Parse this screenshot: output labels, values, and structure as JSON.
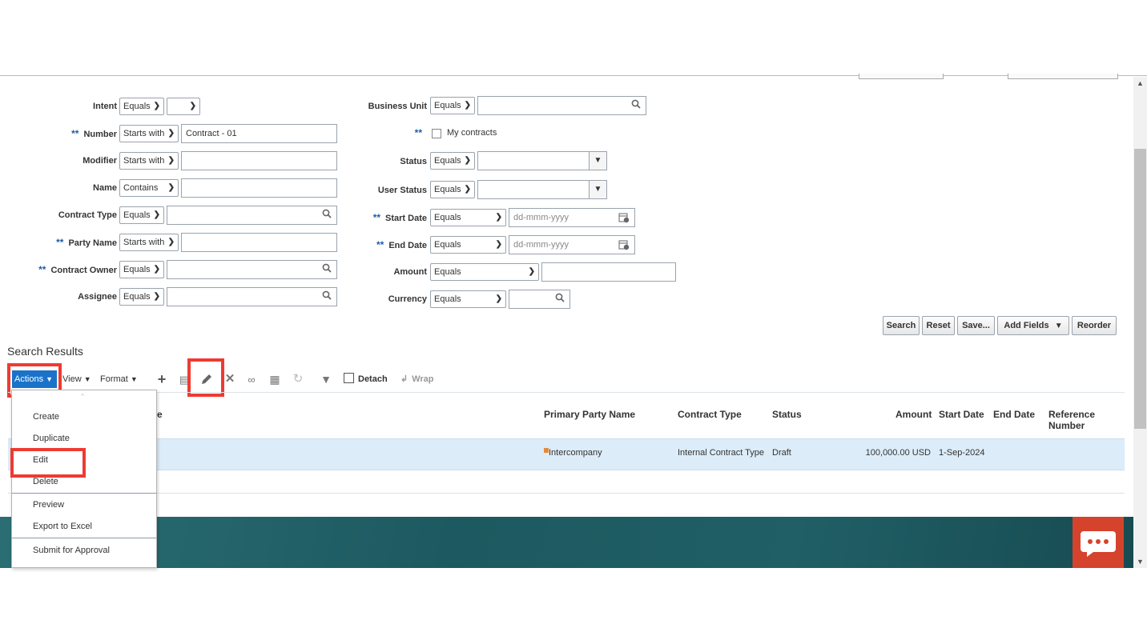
{
  "form": {
    "left": [
      {
        "label": "Intent",
        "required": false,
        "operator": "Equals",
        "value": "",
        "kind": "select-small"
      },
      {
        "label": "Number",
        "required": true,
        "operator": "Starts with",
        "value": "Contract - 01",
        "kind": "text"
      },
      {
        "label": "Modifier",
        "required": false,
        "operator": "Starts with",
        "value": "",
        "kind": "text"
      },
      {
        "label": "Name",
        "required": false,
        "operator": "Contains",
        "value": "",
        "kind": "text"
      },
      {
        "label": "Contract Type",
        "required": false,
        "operator": "Equals",
        "value": "",
        "kind": "search"
      },
      {
        "label": "Party Name",
        "required": true,
        "operator": "Starts with",
        "value": "",
        "kind": "text"
      },
      {
        "label": "Contract Owner",
        "required": true,
        "operator": "Equals",
        "value": "",
        "kind": "search"
      },
      {
        "label": "Assignee",
        "required": false,
        "operator": "Equals",
        "value": "",
        "kind": "search"
      }
    ],
    "right": {
      "business_unit": {
        "label": "Business Unit",
        "operator": "Equals",
        "value": ""
      },
      "my_contracts": {
        "label": "My contracts",
        "checked": false
      },
      "status": {
        "label": "Status",
        "operator": "Equals",
        "value": ""
      },
      "user_status": {
        "label": "User Status",
        "operator": "Equals",
        "value": ""
      },
      "start_date": {
        "label": "Start Date",
        "operator": "Equals",
        "placeholder": "dd-mmm-yyyy"
      },
      "end_date": {
        "label": "End Date",
        "operator": "Equals",
        "placeholder": "dd-mmm-yyyy"
      },
      "amount": {
        "label": "Amount",
        "operator": "Equals",
        "value": ""
      },
      "currency": {
        "label": "Currency",
        "operator": "Equals",
        "value": ""
      }
    },
    "required_marker": "**",
    "buttons": {
      "search": "Search",
      "reset": "Reset",
      "save": "Save...",
      "add_fields": "Add Fields",
      "reorder": "Reorder"
    }
  },
  "results": {
    "title": "Search Results",
    "toolbar": {
      "actions": "Actions",
      "view": "View",
      "format": "Format",
      "detach": "Detach",
      "wrap": "Wrap"
    },
    "columns": {
      "name_tail": "e",
      "primary_party": "Primary Party Name",
      "contract_type": "Contract Type",
      "status": "Status",
      "amount": "Amount",
      "start_date": "Start Date",
      "end_date": "End Date",
      "reference_line1": "Reference",
      "reference_line2": "Number"
    },
    "row": {
      "primary_party": "Intercompany",
      "contract_type": "Internal Contract Type",
      "status": "Draft",
      "amount": "100,000.00 USD",
      "start_date": "1-Sep-2024",
      "end_date": ""
    }
  },
  "actions_menu": {
    "items": [
      "Create",
      "Duplicate",
      "Edit",
      "Delete",
      "Preview",
      "Export to Excel",
      "Submit for Approval"
    ]
  },
  "colors": {
    "accent": "#1a73c9",
    "highlight": "#ee3b32",
    "footer": "#1e5c63",
    "chat": "#d5432c"
  }
}
